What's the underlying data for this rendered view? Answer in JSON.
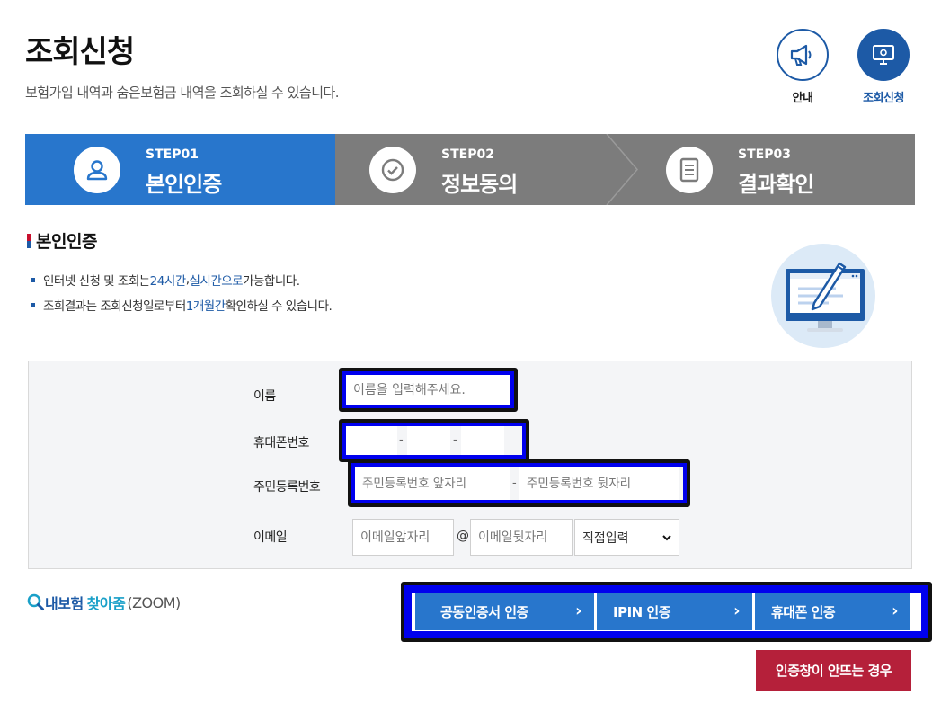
{
  "header": {
    "title": "조회신청",
    "description": "보험가입 내역과 숨은보험금 내역을 조회하실 수 있습니다."
  },
  "quick_menu": [
    {
      "label": "안내",
      "icon": "megaphone-icon"
    },
    {
      "label": "조회신청",
      "icon": "monitor-icon"
    }
  ],
  "steps": [
    {
      "no": "STEP01",
      "name": "본인인증",
      "icon": "user-icon",
      "active": true
    },
    {
      "no": "STEP02",
      "name": "정보동의",
      "icon": "check-circle-icon",
      "active": false
    },
    {
      "no": "STEP03",
      "name": "결과확인",
      "icon": "document-icon",
      "active": false
    }
  ],
  "section": {
    "title": "본인인증",
    "notice1": {
      "pre": "인터넷 신청 및 조회는 ",
      "hl1": "24시간",
      "mid": ", ",
      "hl2": "실시간으로",
      "post": " 가능합니다."
    },
    "notice2": {
      "pre": "조회결과는 조회신청일로부터 ",
      "hl1": "1개월간",
      "post": " 확인하실 수 있습니다."
    }
  },
  "form": {
    "name_label": "이름",
    "name_placeholder": "이름을 입력해주세요.",
    "phone_label": "휴대폰번호",
    "phone_sep": "-",
    "rrn_label": "주민등록번호",
    "rrn_front_placeholder": "주민등록번호 앞자리",
    "rrn_back_placeholder": "주민등록번호 뒷자리",
    "rrn_sep": "-",
    "email_label": "이메일",
    "email_front_placeholder": "이메일앞자리",
    "email_at": "@",
    "email_back_placeholder": "이메일뒷자리",
    "email_domain_selected": "직접입력"
  },
  "zoom": {
    "part1": "내보험",
    "part2": "찾아줌",
    "part3": "(ZOOM)"
  },
  "auth_buttons": [
    {
      "label": "공동인증서 인증"
    },
    {
      "label": "IPIN 인증"
    },
    {
      "label": "휴대폰 인증"
    }
  ],
  "popup_button": "인증창이 안뜨는 경우",
  "colors": {
    "primary": "#2876cc",
    "dark_blue": "#1d5aa6",
    "inactive_step": "#7c7c7c",
    "danger": "#b5203a"
  }
}
